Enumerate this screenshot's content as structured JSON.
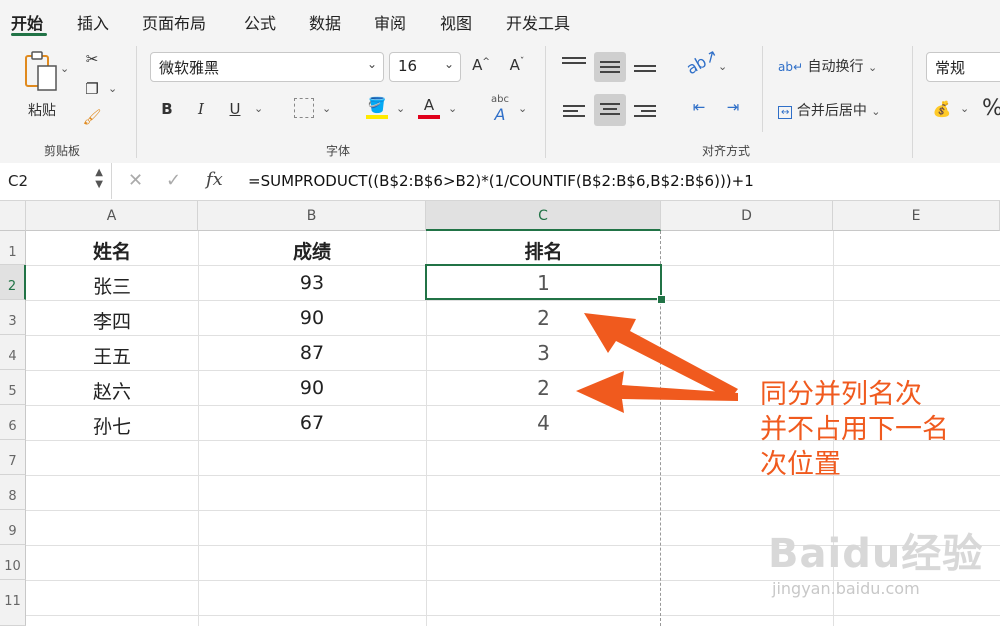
{
  "tabs": [
    "开始",
    "插入",
    "页面布局",
    "公式",
    "数据",
    "审阅",
    "视图",
    "开发工具"
  ],
  "clipboard": {
    "paste_label": "粘贴",
    "group_label": "剪贴板"
  },
  "font": {
    "name": "微软雅黑",
    "size": "16",
    "bold": "B",
    "italic": "I",
    "underline": "U",
    "grow": "A",
    "shrink": "A",
    "group_label": "字体",
    "abc_label": "abc",
    "highlight_color": "#ffea00",
    "font_color": "#e0001b"
  },
  "alignment": {
    "wrap_label": "自动换行",
    "merge_label": "合并后居中",
    "group_label": "对齐方式"
  },
  "number": {
    "format": "常规",
    "percent": "%"
  },
  "formula_bar": {
    "name_box": "C2",
    "fx": "fx",
    "formula": "=SUMPRODUCT((B$2:B$6>B2)*(1/COUNTIF(B$2:B$6,B$2:B$6)))+1"
  },
  "columns": [
    "A",
    "B",
    "C",
    "D",
    "E"
  ],
  "rows": [
    "1",
    "2",
    "3",
    "4",
    "5",
    "6",
    "7",
    "8",
    "9",
    "10",
    "11"
  ],
  "table": {
    "headers": [
      "姓名",
      "成绩",
      "排名"
    ],
    "data": [
      [
        "张三",
        "93",
        "1"
      ],
      [
        "李四",
        "90",
        "2"
      ],
      [
        "王五",
        "87",
        "3"
      ],
      [
        "赵六",
        "90",
        "2"
      ],
      [
        "孙七",
        "67",
        "4"
      ]
    ]
  },
  "annotation": {
    "lines": [
      "同分并列名次",
      "并不占用下一名",
      "次位置"
    ],
    "color": "#f05a1e"
  },
  "watermark": {
    "brand": "Baidu经验",
    "url": "jingyan.baidu.com"
  },
  "accent_color": "#217346"
}
